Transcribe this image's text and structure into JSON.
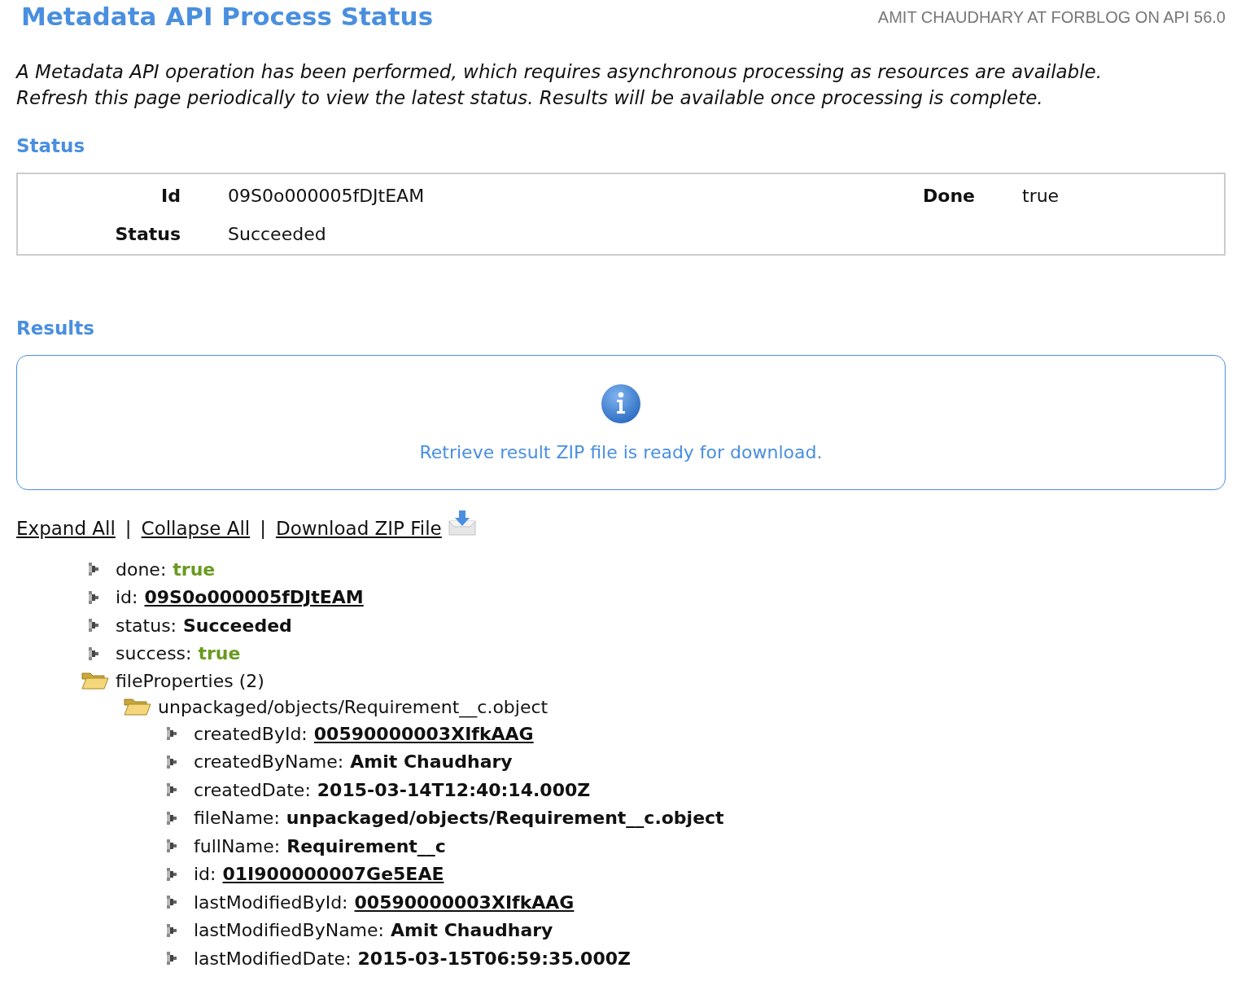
{
  "header": {
    "title": "Metadata API Process Status",
    "user_info": "AMIT CHAUDHARY AT FORBLOG ON API 56.0"
  },
  "intro": "A Metadata API operation has been performed, which requires asynchronous processing as resources are available. Refresh this page periodically to view the latest status. Results will be available once processing is complete.",
  "status_section": {
    "heading": "Status",
    "fields": [
      {
        "label": "Id",
        "value": "09S0o000005fDJtEAM"
      },
      {
        "label": "Done",
        "value": "true"
      },
      {
        "label": "Status",
        "value": "Succeeded"
      }
    ]
  },
  "results_section": {
    "heading": "Results",
    "message": "Retrieve result ZIP file is ready for download."
  },
  "actions": {
    "separator": "|",
    "links": [
      {
        "label": "Expand All",
        "kind": "plain"
      },
      {
        "label": "Collapse All",
        "kind": "plain"
      },
      {
        "label": "Download ZIP File",
        "kind": "download"
      }
    ]
  },
  "tree": [
    {
      "kind": "leaf",
      "key": "done:",
      "value": {
        "text": "true",
        "kind": "bool"
      }
    },
    {
      "kind": "leaf",
      "key": "id:",
      "value": {
        "text": "09S0o000005fDJtEAM",
        "kind": "link"
      }
    },
    {
      "kind": "leaf",
      "key": "status:",
      "value": {
        "text": "Succeeded",
        "kind": "bold"
      }
    },
    {
      "kind": "leaf",
      "key": "success:",
      "value": {
        "text": "true",
        "kind": "bool"
      }
    },
    {
      "kind": "folder",
      "label": "fileProperties (2)",
      "children": [
        {
          "kind": "folder",
          "label": "unpackaged/objects/Requirement__c.object",
          "children": [
            {
              "kind": "leaf",
              "key": "createdById:",
              "value": {
                "text": "00590000003XIfkAAG",
                "kind": "link"
              }
            },
            {
              "kind": "leaf",
              "key": "createdByName:",
              "value": {
                "text": "Amit Chaudhary",
                "kind": "bold"
              }
            },
            {
              "kind": "leaf",
              "key": "createdDate:",
              "value": {
                "text": "2015-03-14T12:40:14.000Z",
                "kind": "bold"
              }
            },
            {
              "kind": "leaf",
              "key": "fileName:",
              "value": {
                "text": "unpackaged/objects/Requirement__c.object",
                "kind": "bold"
              }
            },
            {
              "kind": "leaf",
              "key": "fullName:",
              "value": {
                "text": "Requirement__c",
                "kind": "bold"
              }
            },
            {
              "kind": "leaf",
              "key": "id:",
              "value": {
                "text": "01I900000007Ge5EAE",
                "kind": "link"
              }
            },
            {
              "kind": "leaf",
              "key": "lastModifiedById:",
              "value": {
                "text": "00590000003XIfkAAG",
                "kind": "link"
              }
            },
            {
              "kind": "leaf",
              "key": "lastModifiedByName:",
              "value": {
                "text": "Amit Chaudhary",
                "kind": "bold"
              }
            },
            {
              "kind": "leaf",
              "key": "lastModifiedDate:",
              "value": {
                "text": "2015-03-15T06:59:35.000Z",
                "kind": "bold"
              }
            }
          ]
        }
      ]
    }
  ]
}
